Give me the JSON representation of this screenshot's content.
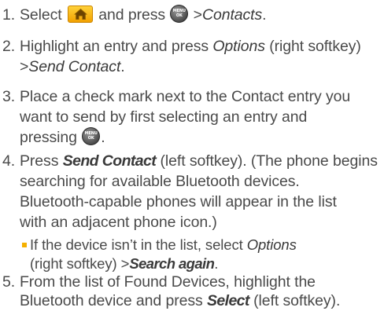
{
  "steps": [
    {
      "num": "1.",
      "select_text": "Select",
      "home_key_icon": "home-key-icon",
      "and_press": "and press",
      "menu_key_icon": "menu-ok-key-icon",
      "menu_key_label_top": "MENU",
      "menu_key_label_bottom": "OK",
      "arrow": ">",
      "target": "Contacts",
      "period": "."
    },
    {
      "num": "2.",
      "line1_pre": "Highlight an entry and press",
      "line1_em": "Options",
      "line1_post": "(right softkey)",
      "line2_arrow": ">",
      "line2_em": "Send Contact",
      "line2_post": "."
    },
    {
      "num": "3.",
      "line1": "Place a check mark next to the Contact entry you",
      "line2": "want to send by first selecting an entry and",
      "line3_pre": "pressing",
      "menu_key_label_top": "MENU",
      "menu_key_label_bottom": "OK",
      "line3_post": "."
    },
    {
      "num": "4.",
      "line1_pre": "Press",
      "line1_em": "Send Contact",
      "line1_post": "(left softkey). (The phone begins",
      "line2": "searching for available Bluetooth devices.",
      "line3": "Bluetooth-capable phones will appear in the list",
      "line4": "with an adjacent phone icon.)"
    },
    {
      "num": "5.",
      "line1": "From the list of Found Devices, highlight the",
      "line2_pre": "Bluetooth device and press",
      "line2_em": "Select",
      "line2_post": "(left softkey)."
    }
  ],
  "sub_bullet": {
    "line1_pre": "If the device isn’t in the list, select",
    "line1_em": "Options",
    "line2_pre": "(right softkey)",
    "line2_arrow": ">",
    "line2_em": "Search again",
    "line2_post": "."
  },
  "colors": {
    "text": "#4a4a4a",
    "bullet": "#f5b000",
    "home_key": "#f5b000",
    "menu_key": "#4d4d4d"
  }
}
